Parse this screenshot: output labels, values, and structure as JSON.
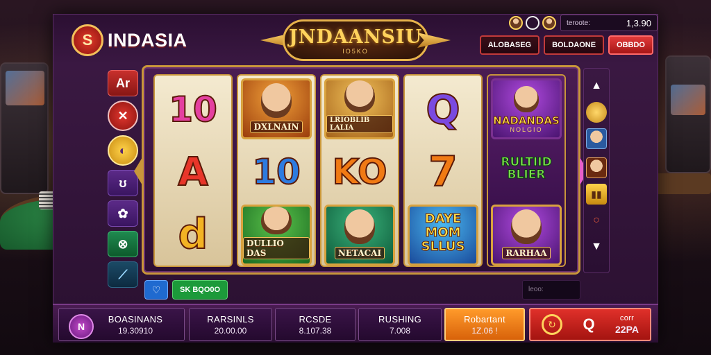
{
  "header": {
    "brand_logo_glyph": "S",
    "brand_name": "INDASIA",
    "title": "JNDAANSIU",
    "title_sub": "IO5KO",
    "balance_label": "teroote:",
    "balance_value": "1,3.90",
    "buttons": [
      "ALOBASEG",
      "BOLDAONE",
      "OBBDO"
    ]
  },
  "left_buttons": [
    {
      "label": "Ar",
      "icon": "text"
    },
    {
      "label": "✕",
      "icon": "close-icon"
    },
    {
      "label": "◐",
      "icon": "gold-coin-icon"
    },
    {
      "label": "ʊ",
      "icon": "rotate-icon"
    },
    {
      "label": "✿",
      "icon": "flower-icon"
    },
    {
      "label": "⊗",
      "icon": "link-icon"
    },
    {
      "label": "⟋",
      "icon": "mute-icon"
    }
  ],
  "reels": {
    "reel1": [
      "10",
      "A",
      "d"
    ],
    "reel2": {
      "top_label": "DXLNAIN",
      "mid": "10",
      "bottom_label": "DULLIO DAS"
    },
    "reel3": {
      "top_label": "LRIOBLIB LALIA",
      "mid": "KO",
      "bottom_label": "NETACAI"
    },
    "reel4": {
      "top": "Q",
      "mid": "7",
      "bottom_label": "DAYE MOM SLLUS"
    },
    "reel5": {
      "top_label": "NADANDAS",
      "top_sub": "NOLGIO",
      "mid": "RULTIID BLIER",
      "bottom_label": "RARHAA"
    }
  },
  "bottom_strip": {
    "button_label": "SK BQO0O",
    "field_text": "leoo:"
  },
  "footer": {
    "menu_glyph": "N",
    "stats": [
      {
        "label": "BOASINANS",
        "value": "19.30910"
      },
      {
        "label": "RARSINLS",
        "value": "20.00.00"
      },
      {
        "label": "RCSDE",
        "value": "8.107.38"
      },
      {
        "label": "RUSHING",
        "value": "7.008"
      }
    ],
    "bet": {
      "label": "Robartant",
      "value": "1Z.06 !"
    },
    "auto": {
      "label": "corr",
      "value": "22PA"
    }
  },
  "colors": {
    "accent_gold": "#c9963a",
    "accent_red": "#e0302a",
    "accent_orange": "#ff9a2a",
    "panel_purple": "#3d1a45"
  }
}
